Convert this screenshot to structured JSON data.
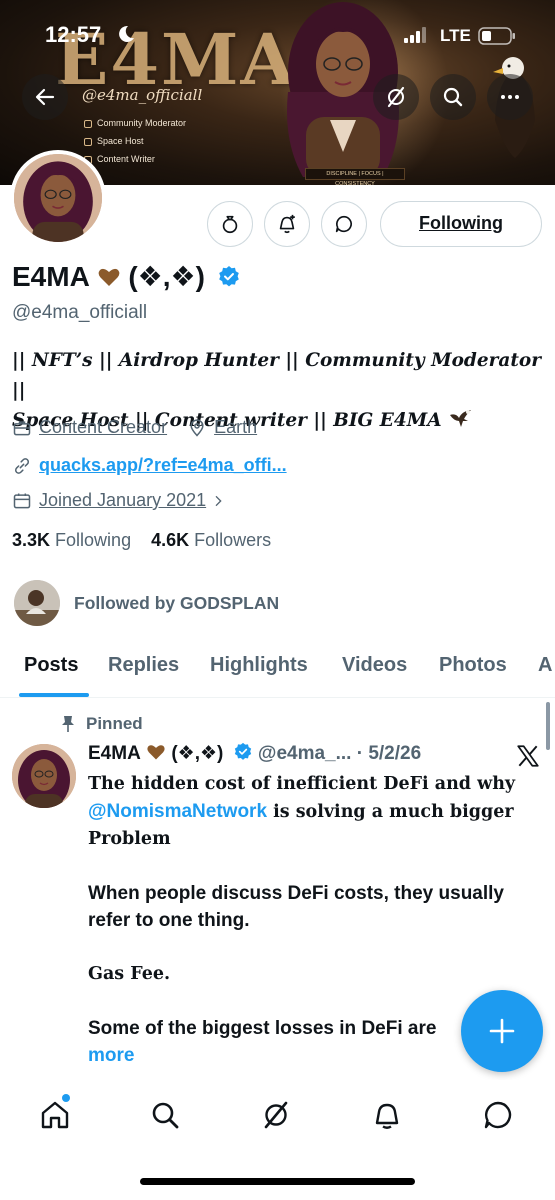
{
  "status_bar": {
    "time": "12:57",
    "network": "LTE"
  },
  "banner": {
    "brand_text": "E4MA",
    "handle_script": "@e4ma_officiall",
    "lines": [
      "Community Moderator",
      "Space Host",
      "Content Writer"
    ],
    "desk_sign": "DISCIPLINE | FOCUS | CONSISTENCY"
  },
  "header_buttons": {
    "back_icon": "arrow-left-icon",
    "grok_icon": "grok-icon",
    "search_icon": "search-icon",
    "more_icon": "more-icon"
  },
  "profile": {
    "name": "E4MA",
    "name_suffix": "(❖,❖)",
    "handle": "@e4ma_officiall",
    "bio_line1": "|| NFT’s || Airdrop Hunter || Community Moderator ||",
    "bio_line2": "Space Host || Content writer || BIG E4MA",
    "category": "Content Creator",
    "location": "Earth",
    "website": "quacks.app/?ref=e4ma_offi...",
    "joined": "Joined January 2021",
    "following_count": "3.3K",
    "following_label": "Following",
    "followers_count": "4.6K",
    "followers_label": "Followers",
    "followed_by": "Followed by GODSPLAN"
  },
  "actions": {
    "following_button": "Following"
  },
  "tabs": [
    "Posts",
    "Replies",
    "Highlights",
    "Videos",
    "Photos",
    "A"
  ],
  "tweet": {
    "pinned_label": "Pinned",
    "author": "E4MA",
    "author_suffix": "(❖,❖)",
    "handle_date": "@e4ma_... · 5/2/26",
    "line1": "The hidden cost of inefficient DeFi and why",
    "mention": "@NomismaNetwork",
    "line2": " is solving a much bigger Problem",
    "para2": "When people discuss DeFi costs, they usually refer to one thing.",
    "para3": "Gas Fee.",
    "para4": "Some of the biggest losses in DeFi are",
    "more": "more"
  },
  "colors": {
    "accent": "#1d9bf0",
    "text": "#0f1419",
    "muted": "#536471",
    "border": "#cfd9de"
  }
}
